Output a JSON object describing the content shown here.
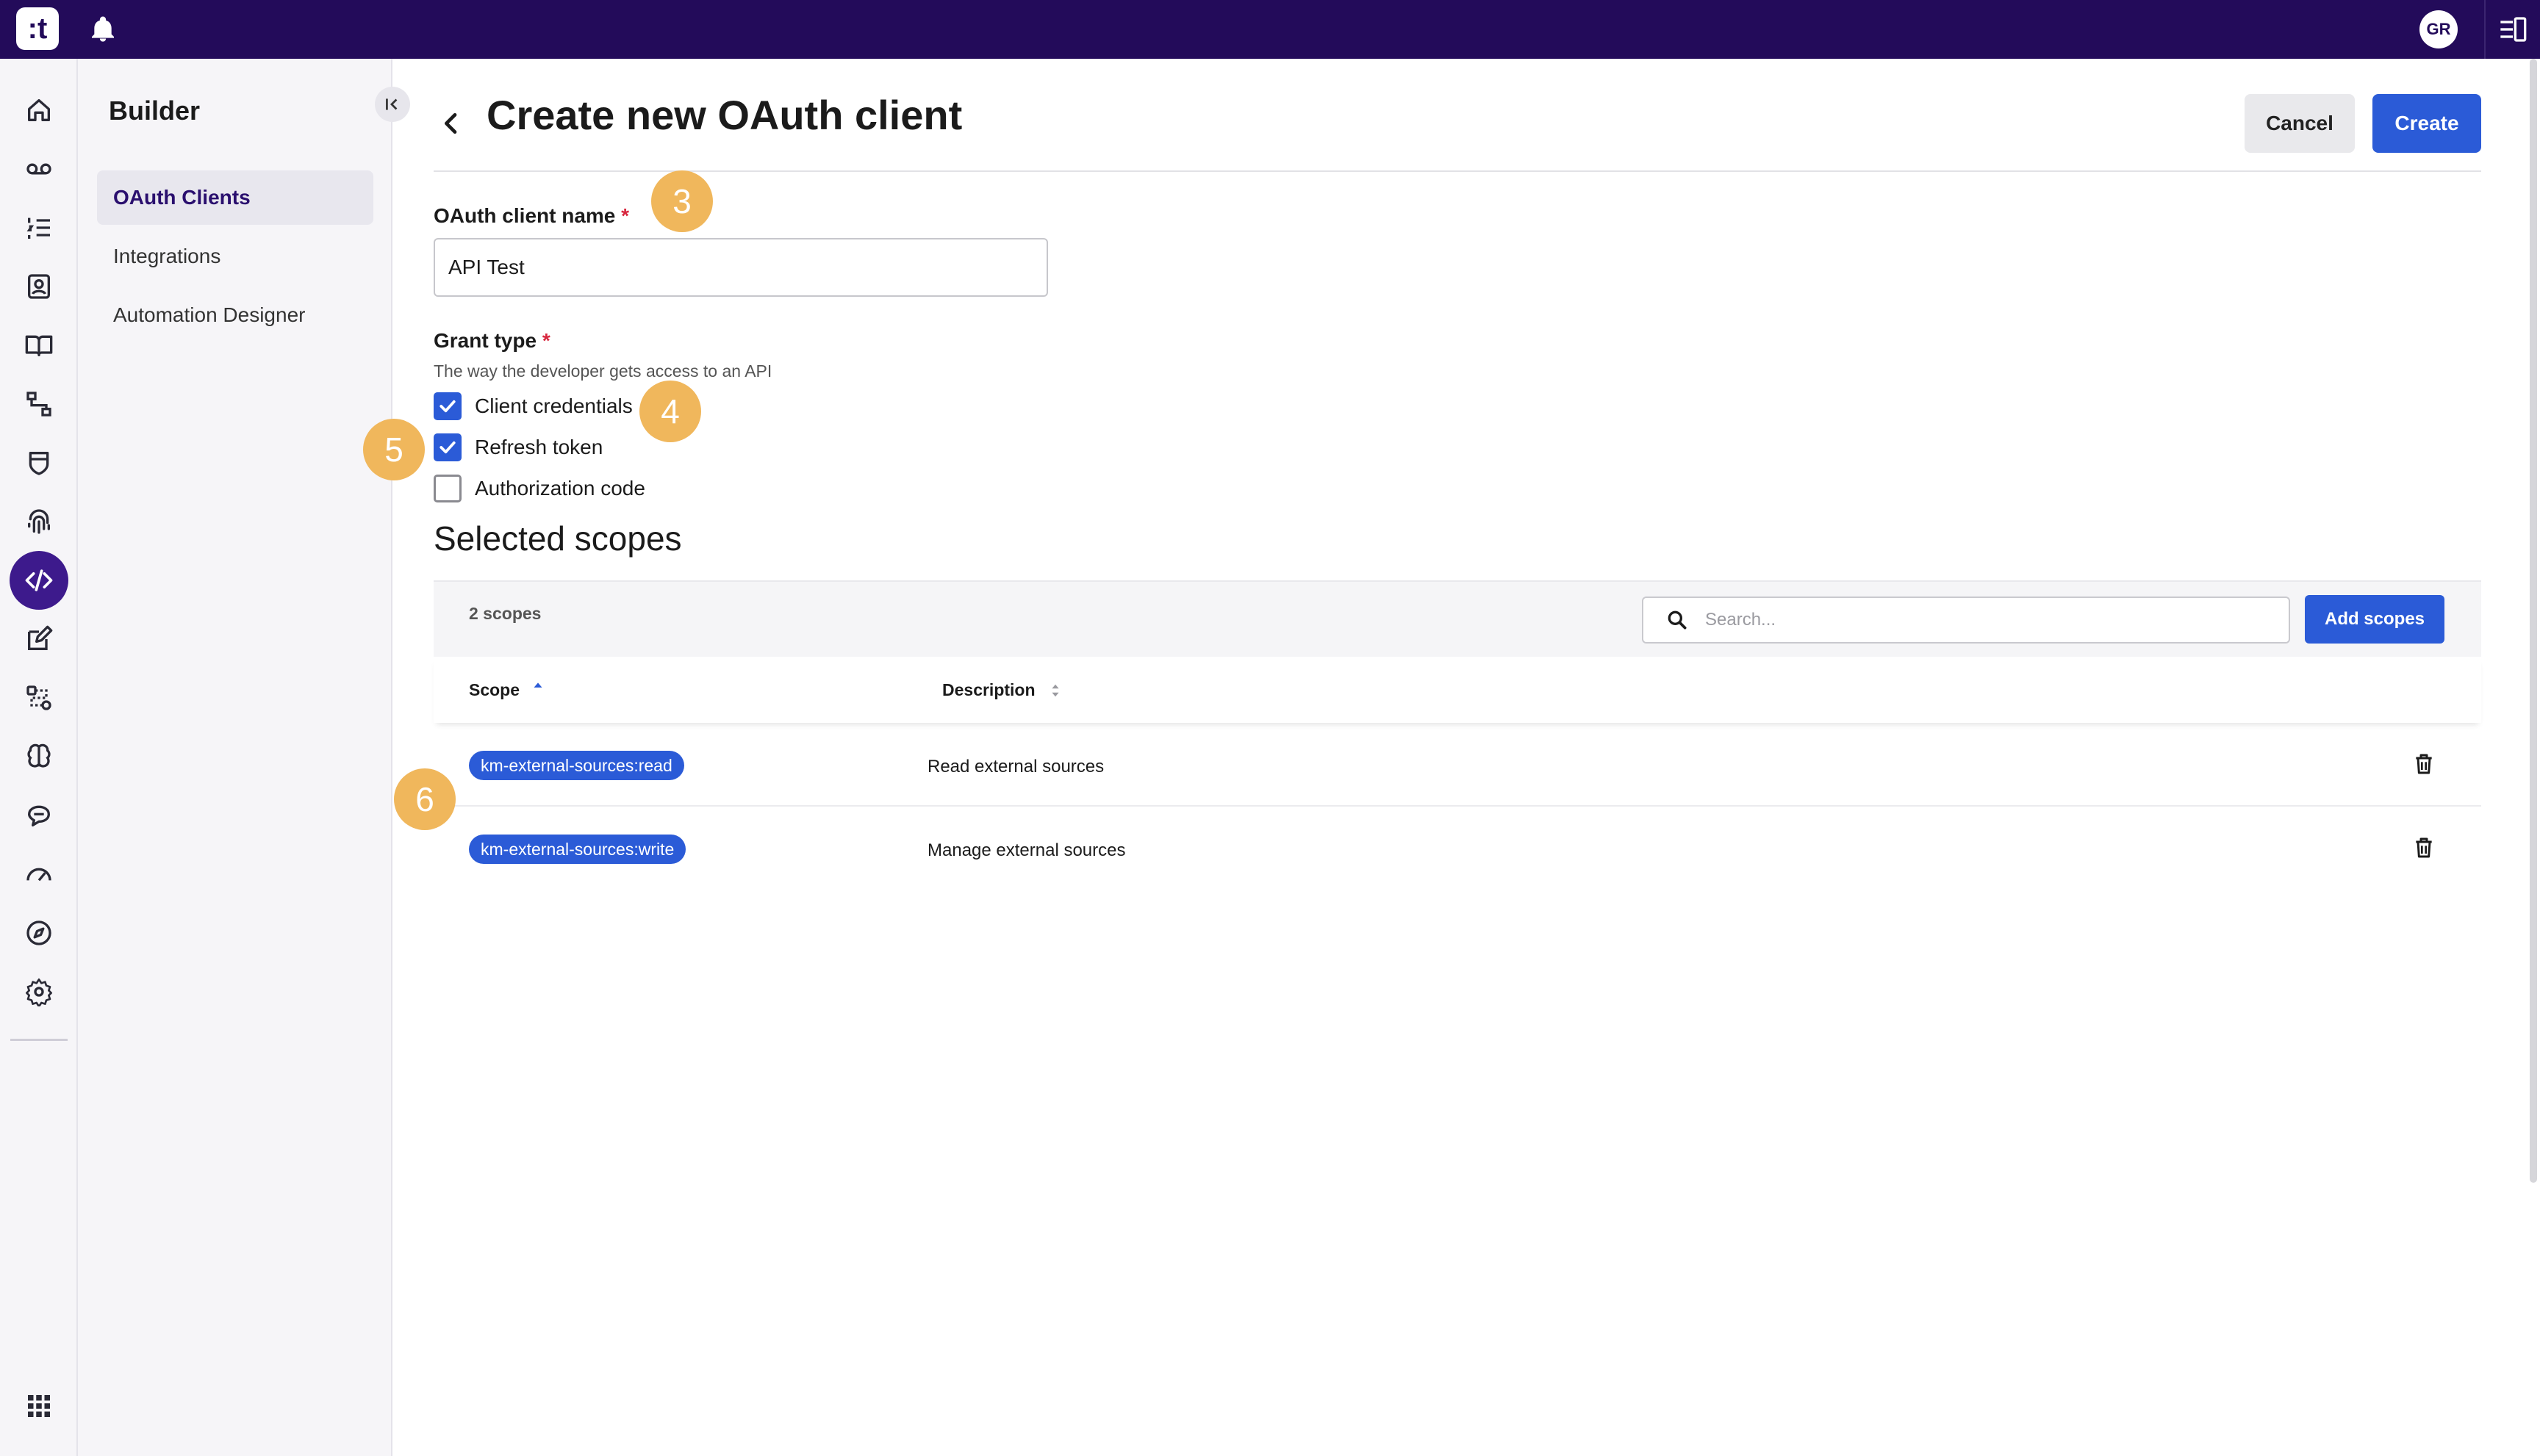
{
  "topbar": {
    "logo_text": ":t",
    "avatar_initials": "GR",
    "colors": {
      "bar": "#230b5a"
    }
  },
  "rail": {
    "icons": [
      "home-icon",
      "voicemail-icon",
      "list-icon",
      "contacts-icon",
      "knowledge-book-icon",
      "flow-icon",
      "shield-icon",
      "fingerprint-icon",
      "code-icon",
      "edit-icon",
      "workflow-icon",
      "brain-icon",
      "chat-icon",
      "gauge-icon",
      "compass-icon",
      "gear-icon"
    ],
    "active": "code-icon",
    "bottom_icon": "apps-grid-icon"
  },
  "sidebar": {
    "title": "Builder",
    "items": [
      {
        "label": "OAuth Clients",
        "active": true
      },
      {
        "label": "Integrations",
        "active": false
      },
      {
        "label": "Automation Designer",
        "active": false
      }
    ]
  },
  "header": {
    "title": "Create new OAuth client",
    "cancel_label": "Cancel",
    "create_label": "Create"
  },
  "form": {
    "name_label": "OAuth client name",
    "required_mark": "*",
    "name_value": "API Test",
    "grant_label": "Grant type",
    "grant_help": "The way the developer gets access to an API",
    "grant_options": [
      {
        "label": "Client credentials",
        "checked": true
      },
      {
        "label": "Refresh token",
        "checked": true
      },
      {
        "label": "Authorization code",
        "checked": false
      }
    ]
  },
  "scopes": {
    "title": "Selected scopes",
    "count_label": "2 scopes",
    "search_placeholder": "Search...",
    "add_label": "Add scopes",
    "columns": {
      "scope": "Scope",
      "description": "Description"
    },
    "rows": [
      {
        "scope": "km-external-sources:read",
        "description": "Read external sources"
      },
      {
        "scope": "km-external-sources:write",
        "description": "Manage external sources"
      }
    ]
  },
  "markers": [
    "3",
    "4",
    "5",
    "6"
  ],
  "colors": {
    "primary": "#2b5bd7",
    "marker": "#f0b75c",
    "required": "#d7263d"
  }
}
